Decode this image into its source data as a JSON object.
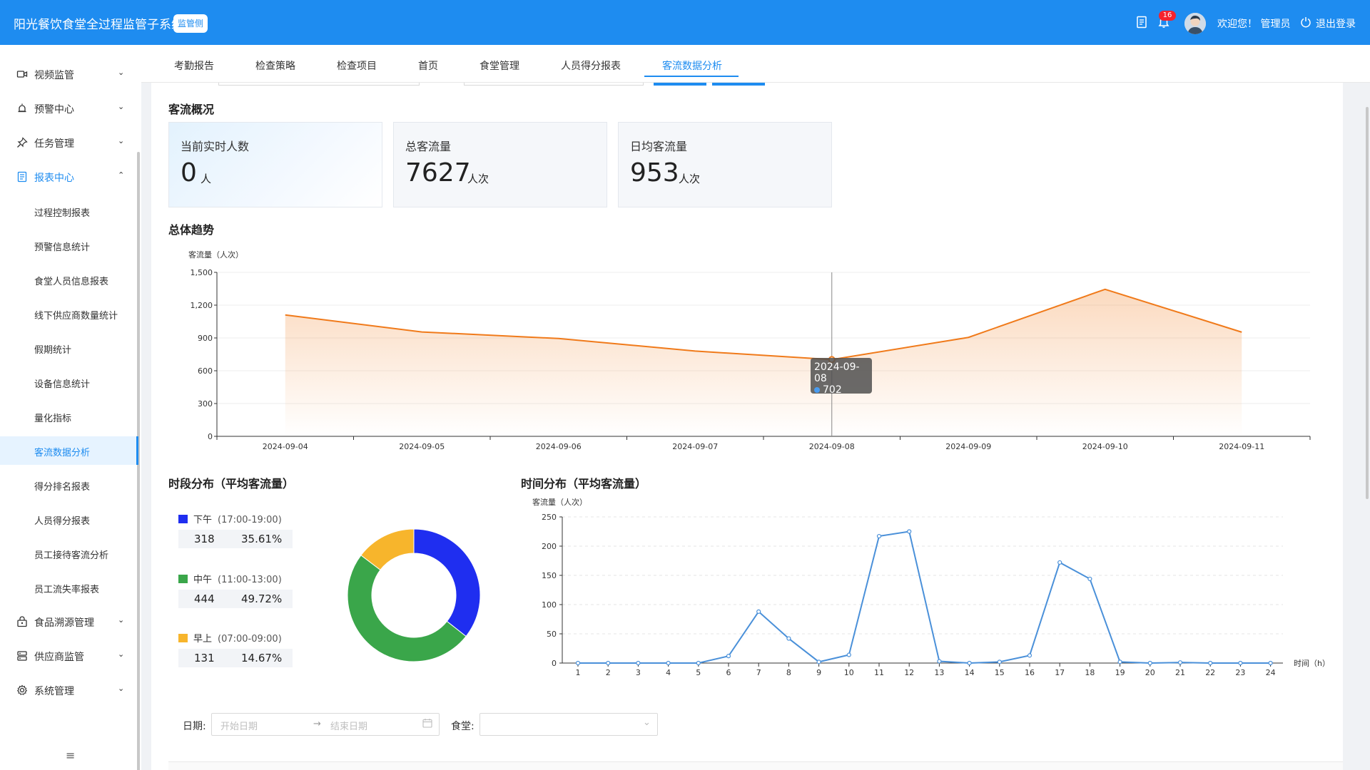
{
  "header": {
    "app_title": "阳光餐饮食堂全过程监管子系统 -",
    "side_badge": "监管侧",
    "notice_count": "16",
    "welcome": "欢迎您！ 管理员",
    "logout": "退出登录"
  },
  "sidebar": {
    "items": [
      {
        "label": "视频监管",
        "icon": "video-icon"
      },
      {
        "label": "预警中心",
        "icon": "alarm-icon"
      },
      {
        "label": "任务管理",
        "icon": "pin-icon"
      },
      {
        "label": "报表中心",
        "icon": "report-icon"
      },
      {
        "label": "食品溯源管理",
        "icon": "lock-box-icon"
      },
      {
        "label": "供应商监管",
        "icon": "server-icon"
      },
      {
        "label": "系统管理",
        "icon": "gear-icon"
      }
    ],
    "sub_items": [
      "过程控制报表",
      "预警信息统计",
      "食堂人员信息报表",
      "线下供应商数量统计",
      "假期统计",
      "设备信息统计",
      "量化指标",
      "客流数据分析",
      "得分排名报表",
      "人员得分报表",
      "员工接待客流分析",
      "员工流失率报表"
    ],
    "active_sub": "客流数据分析"
  },
  "tabs": [
    "考勤报告",
    "检查策略",
    "检查项目",
    "首页",
    "食堂管理",
    "人员得分报表",
    "客流数据分析"
  ],
  "overview": {
    "title": "客流概况",
    "cards": [
      {
        "label": "当前实时人数",
        "value": "0",
        "unit": "人"
      },
      {
        "label": "总客流量",
        "value": "7627",
        "unit": "人次"
      },
      {
        "label": "日均客流量",
        "value": "953",
        "unit": "人次"
      }
    ]
  },
  "trend": {
    "title": "总体趋势",
    "tooltip_date": "2024-09-08",
    "tooltip_value": "702"
  },
  "period": {
    "title": "时段分布（平均客流量）",
    "rows": [
      {
        "name": "下午",
        "range": "(17:00-19:00)",
        "value": "318",
        "pct": "35.61%",
        "color": "#1f2ef0"
      },
      {
        "name": "中午",
        "range": "(11:00-13:00)",
        "value": "444",
        "pct": "49.72%",
        "color": "#3aa64a"
      },
      {
        "name": "早上",
        "range": "(07:00-09:00)",
        "value": "131",
        "pct": "14.67%",
        "color": "#f7b52c"
      }
    ]
  },
  "hourly": {
    "title": "时间分布（平均客流量）"
  },
  "filters": {
    "date_label": "日期:",
    "start_placeholder": "开始日期",
    "end_placeholder": "结束日期",
    "canteen_label": "食堂:"
  },
  "chart_data": [
    {
      "type": "area",
      "title": "",
      "ylabel": "客流量（人次）",
      "xlabel": "",
      "x": [
        "2024-09-04",
        "2024-09-05",
        "2024-09-06",
        "2024-09-07",
        "2024-09-08",
        "2024-09-09",
        "2024-09-10",
        "2024-09-11"
      ],
      "values": [
        1110,
        955,
        895,
        780,
        702,
        905,
        1345,
        953
      ],
      "ylim": [
        0,
        1500
      ],
      "yticks": [
        "0",
        "300",
        "600",
        "900",
        "1,200",
        "1,500"
      ],
      "color": "#f07a1a",
      "grid": true
    },
    {
      "type": "pie",
      "labels": [
        "下午",
        "中午",
        "早上"
      ],
      "values": [
        318,
        444,
        131
      ],
      "colors": [
        "#1f2ef0",
        "#3aa64a",
        "#f7b52c"
      ]
    },
    {
      "type": "line",
      "ylabel": "客流量（人次）",
      "xlabel": "时间（h）",
      "x": [
        1,
        2,
        3,
        4,
        5,
        6,
        7,
        8,
        9,
        10,
        11,
        12,
        13,
        14,
        15,
        16,
        17,
        18,
        19,
        20,
        21,
        22,
        23,
        24
      ],
      "values": [
        0,
        0,
        0,
        0,
        0,
        12,
        88,
        42,
        2,
        14,
        217,
        225,
        3,
        0,
        2,
        13,
        172,
        144,
        2,
        0,
        1,
        0,
        0,
        0
      ],
      "ylim": [
        0,
        250
      ],
      "yticks": [
        0,
        50,
        100,
        150,
        200,
        250
      ],
      "color": "#4a90d9",
      "grid": true
    }
  ]
}
